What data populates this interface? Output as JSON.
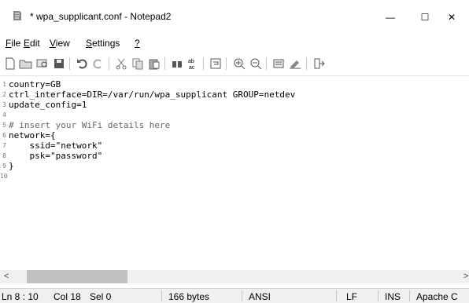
{
  "window": {
    "title": "* wpa_supplicant.conf - Notepad2",
    "controls": {
      "minimize": "—",
      "maximize": "☐",
      "close": "✕"
    }
  },
  "menu": [
    {
      "name": "file",
      "accel": "F",
      "rest": "ile"
    },
    {
      "name": "edit",
      "accel": "E",
      "rest": "dit"
    },
    {
      "name": "view",
      "accel": "V",
      "rest": "iew"
    },
    {
      "name": "settings",
      "accel": "S",
      "rest": "ettings"
    },
    {
      "name": "help",
      "accel": "?",
      "rest": ""
    }
  ],
  "toolbar_icons": [
    "new-file-icon",
    "open-folder-icon",
    "browse-icon",
    "save-icon",
    "undo-icon",
    "redo-icon",
    "cut-icon",
    "copy-icon",
    "paste-icon",
    "find-icon",
    "replace-icon",
    "word-wrap-icon",
    "zoom-in-icon",
    "zoom-out-icon",
    "scheme-icon",
    "customize-icon",
    "exit-icon"
  ],
  "editor": {
    "lines": [
      {
        "n": "1",
        "text": "country=GB"
      },
      {
        "n": "2",
        "text": "ctrl_interface=DIR=/var/run/wpa_supplicant GROUP=netdev"
      },
      {
        "n": "3",
        "text": "update_config=1"
      },
      {
        "n": "4",
        "text": ""
      },
      {
        "n": "5",
        "text": "# insert your WiFi details here",
        "comment": true
      },
      {
        "n": "6",
        "text": "network={"
      },
      {
        "n": "7",
        "text": "    ssid=\"network\""
      },
      {
        "n": "8",
        "text": "    psk=\"password\""
      },
      {
        "n": "9",
        "text": "}"
      },
      {
        "n": "10",
        "text": ""
      }
    ]
  },
  "statusbar": {
    "position": "Ln 8 : 10",
    "column": "Col 18",
    "selection": "Sel 0",
    "size": "166 bytes",
    "encoding": "ANSI",
    "line_ending": "LF",
    "mode": "INS",
    "lexer": "Apache C"
  },
  "scrollbar": {
    "left_arrow": "<",
    "right_arrow": ">"
  }
}
